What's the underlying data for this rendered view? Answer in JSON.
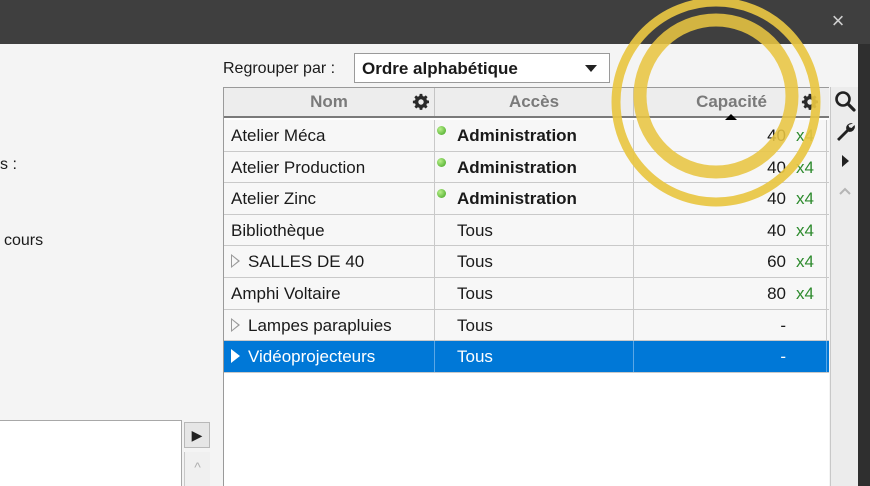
{
  "window": {
    "close_glyph": "×"
  },
  "left_panel": {
    "fragment_1": "s :",
    "fragment_2": "cours",
    "scroll_right_glyph": "▶",
    "scroll_up_glyph": "^"
  },
  "grouping": {
    "label": "Regrouper par :",
    "selected": "Ordre alphabétique"
  },
  "table": {
    "columns": {
      "nom": "Nom",
      "acces": "Accès",
      "capacite": "Capacité"
    },
    "rows": [
      {
        "nom": "Atelier Méca",
        "acces": "Administration",
        "capacite": "40",
        "mult": "x4"
      },
      {
        "nom": "Atelier Production",
        "acces": "Administration",
        "capacite": "40",
        "mult": "x4"
      },
      {
        "nom": "Atelier Zinc",
        "acces": "Administration",
        "capacite": "40",
        "mult": "x4"
      },
      {
        "nom": "Bibliothèque",
        "acces": "Tous",
        "capacite": "40",
        "mult": "x4"
      },
      {
        "nom": "SALLES DE 40",
        "acces": "Tous",
        "capacite": "60",
        "mult": "x4"
      },
      {
        "nom": "Amphi Voltaire",
        "acces": "Tous",
        "capacite": "80",
        "mult": "x4"
      },
      {
        "nom": "Lampes parapluies",
        "acces": "Tous",
        "capacite": "-",
        "mult": ""
      },
      {
        "nom": "Vidéoprojecteurs",
        "acces": "Tous",
        "capacite": "-",
        "mult": ""
      }
    ]
  },
  "side_toolbar": {
    "icons": [
      "search-icon",
      "wrench-icon",
      "play-right-icon",
      "chevron-up-icon"
    ]
  },
  "colors": {
    "selection": "#0078d7",
    "highlight_ring": "#e8c542",
    "multiplier": "#2e8b2e"
  }
}
